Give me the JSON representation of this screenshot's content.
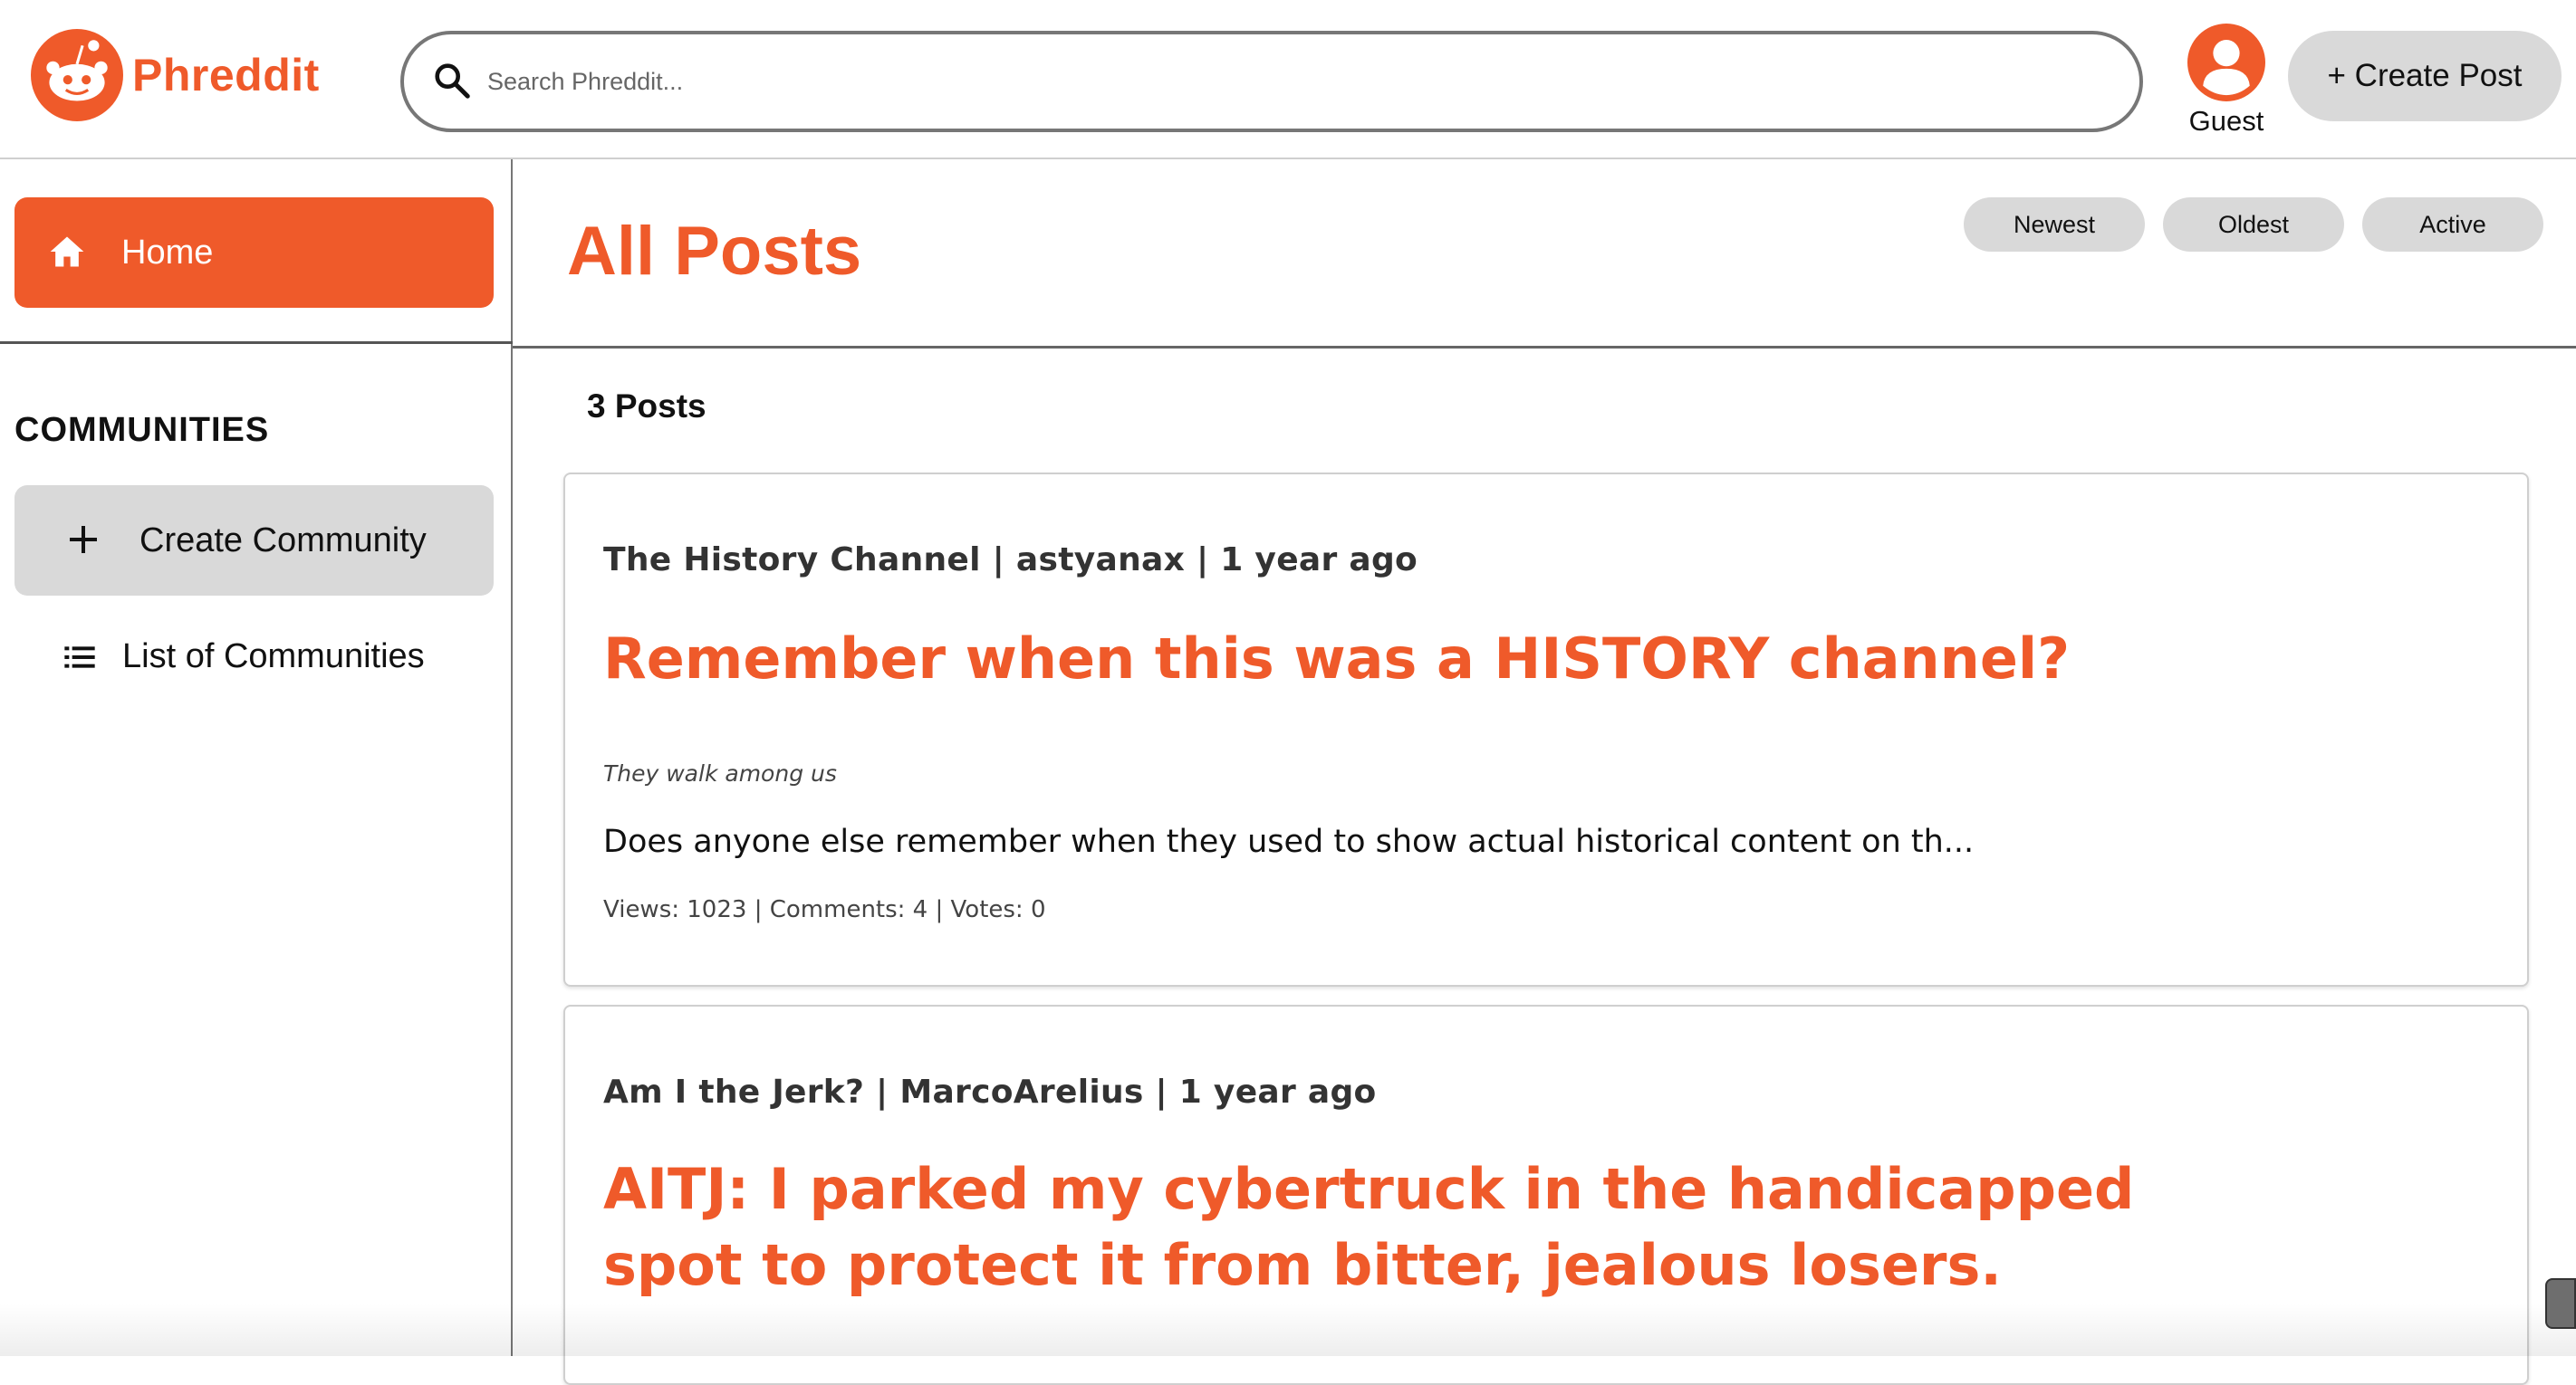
{
  "header": {
    "app_name": "Phreddit",
    "search": {
      "placeholder": "Search Phreddit..."
    },
    "user": {
      "name": "Guest"
    },
    "create_post_label": "+ Create Post"
  },
  "sidebar": {
    "home_label": "Home",
    "communities_title": "COMMUNITIES",
    "create_community_label": "Create Community",
    "list_communities_label": "List of Communities"
  },
  "main": {
    "title": "All Posts",
    "sort_options": [
      "Newest",
      "Oldest",
      "Active"
    ],
    "post_count": "3 Posts",
    "posts": [
      {
        "meta": "The History Channel | astyanax | 1 year ago",
        "title": "Remember when this was a HISTORY channel?",
        "flair": "They walk among us",
        "preview": "Does anyone else remember when they used to show actual historical content on th...",
        "stats": "Views: 1023 | Comments: 4 | Votes: 0"
      },
      {
        "meta": "Am I the Jerk? | MarcoArelius | 1 year ago",
        "title": "AITJ: I parked my cybertruck in the handicapped spot to protect it from bitter, jealous losers."
      }
    ]
  },
  "colors": {
    "accent": "#ef5a2a",
    "button_gray": "#d9d9d9"
  },
  "icons": [
    "reddit-logo-icon",
    "search-icon",
    "user-avatar-icon",
    "home-icon",
    "plus-icon",
    "list-icon"
  ]
}
